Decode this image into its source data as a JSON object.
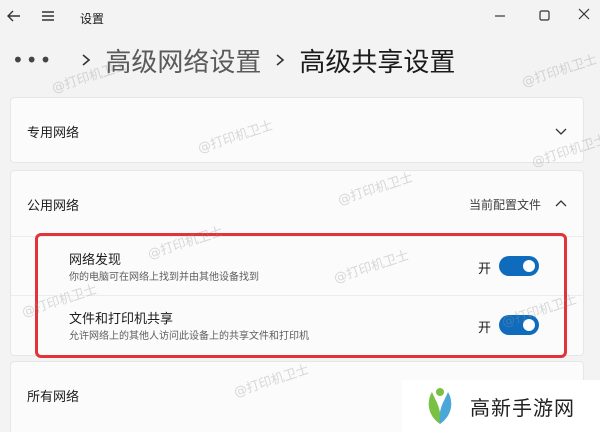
{
  "app": {
    "title": "设置"
  },
  "breadcrumb": {
    "dots": "•••",
    "parent": "高级网络设置",
    "current": "高级共享设置"
  },
  "sections": {
    "private": {
      "title": "专用网络"
    },
    "public": {
      "title": "公用网络",
      "profile_label": "当前配置文件",
      "settings": [
        {
          "title": "网络发现",
          "description": "你的电脑可在网络上找到并由其他设备找到",
          "state": "开",
          "enabled": true
        },
        {
          "title": "文件和打印机共享",
          "description": "允许网络上的其他人访问此设备上的共享文件和打印机",
          "state": "开",
          "enabled": true
        }
      ]
    },
    "all": {
      "title": "所有网络"
    }
  },
  "watermark": {
    "text": "@打印机卫士"
  },
  "brand": {
    "name": "高新手游网"
  },
  "colors": {
    "accent": "#0f6cbd",
    "highlight": "#e2323a",
    "background": "#f3f3f3",
    "card": "#fbfbfb",
    "brand_green": "#7ac143"
  }
}
